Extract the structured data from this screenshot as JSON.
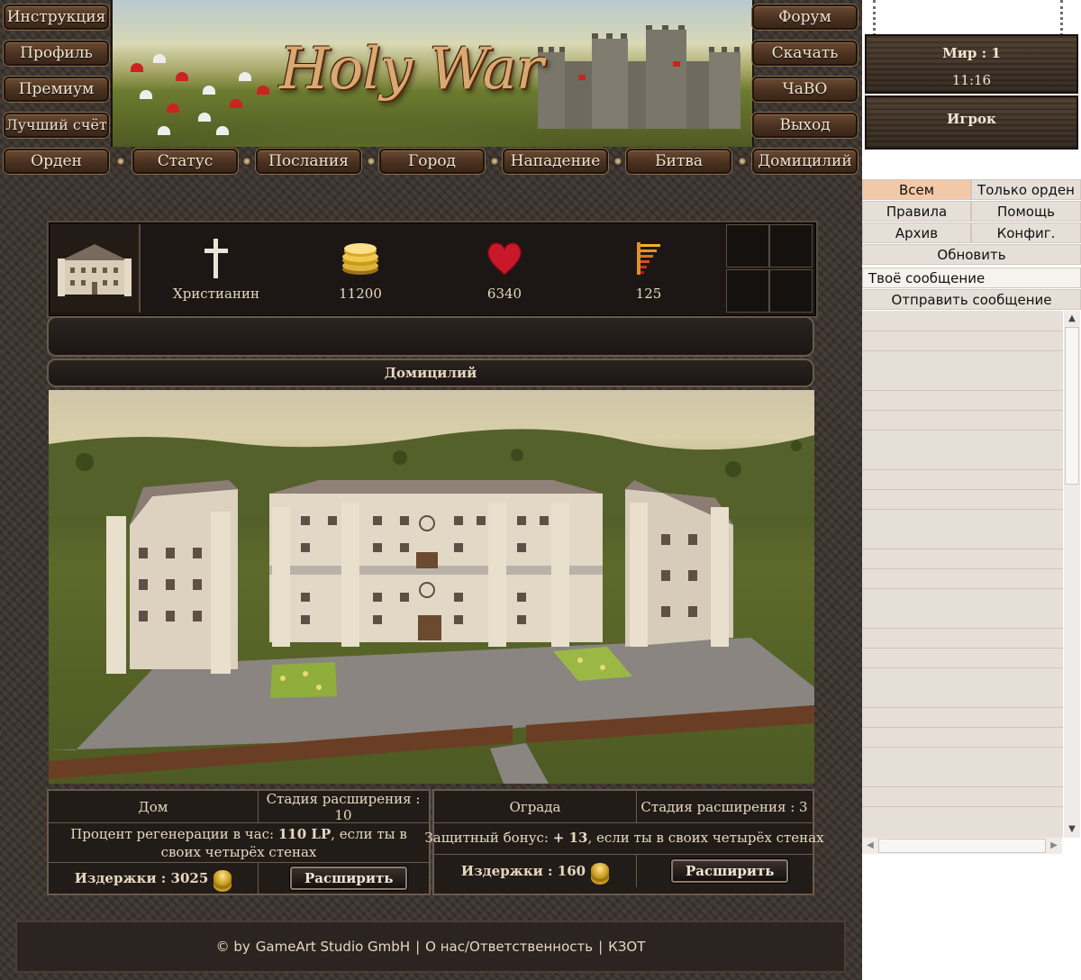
{
  "game": {
    "logo": "Holy War",
    "left_menu": [
      "Инструкция",
      "Профиль",
      "Премиум",
      "Лучший счёт"
    ],
    "right_menu": [
      "Форум",
      "Скачать",
      "ЧаВО",
      "Выход"
    ],
    "nav": [
      "Орден",
      "Статус",
      "Послания",
      "Город",
      "Нападение",
      "Битва",
      "Домицилий"
    ],
    "stats": {
      "religion": "Христианин",
      "gold": "11200",
      "life": "6340",
      "rank": "125"
    },
    "section_title": "Домицилий",
    "house": {
      "name": "Дом",
      "stage": "Стадия расширения : 10",
      "desc_pre": "Процент регенерации в час: ",
      "desc_value": "110 LP",
      "desc_post": ", если ты в своих четырёх стенах",
      "cost": "Издержки : 3025",
      "button": "Расширить"
    },
    "fence": {
      "name": "Ограда",
      "stage": "Стадия расширения : 3",
      "desc_pre": "Защитный бонус: ",
      "desc_value": "+ 13",
      "desc_post": ", если ты в своих четырёх стенах",
      "cost": "Издержки : 160",
      "button": "Расширить"
    },
    "footer": {
      "copyright": "© by",
      "company": "GameArt Studio GmbH",
      "sep": "|",
      "about": "О нас/Ответственность",
      "kzot": "КЗОТ"
    }
  },
  "sidebar": {
    "world": "Мир : 1",
    "time": "11:16",
    "player": "Игрок"
  },
  "chat": {
    "tab_all": "Всем",
    "tab_order": "Только орден",
    "rules": "Правила",
    "help": "Помощь",
    "archive": "Архив",
    "config": "Конфиг.",
    "refresh": "Обновить",
    "message_placeholder": "Твоё сообщение",
    "send": "Отправить сообщение"
  },
  "colors": {
    "wood": "#4a3120",
    "stone": "#3b342e",
    "gold_text": "#f1e6d4",
    "chat_active_tab": "#f0c8a8",
    "chat_bg": "#e6dfd8"
  }
}
